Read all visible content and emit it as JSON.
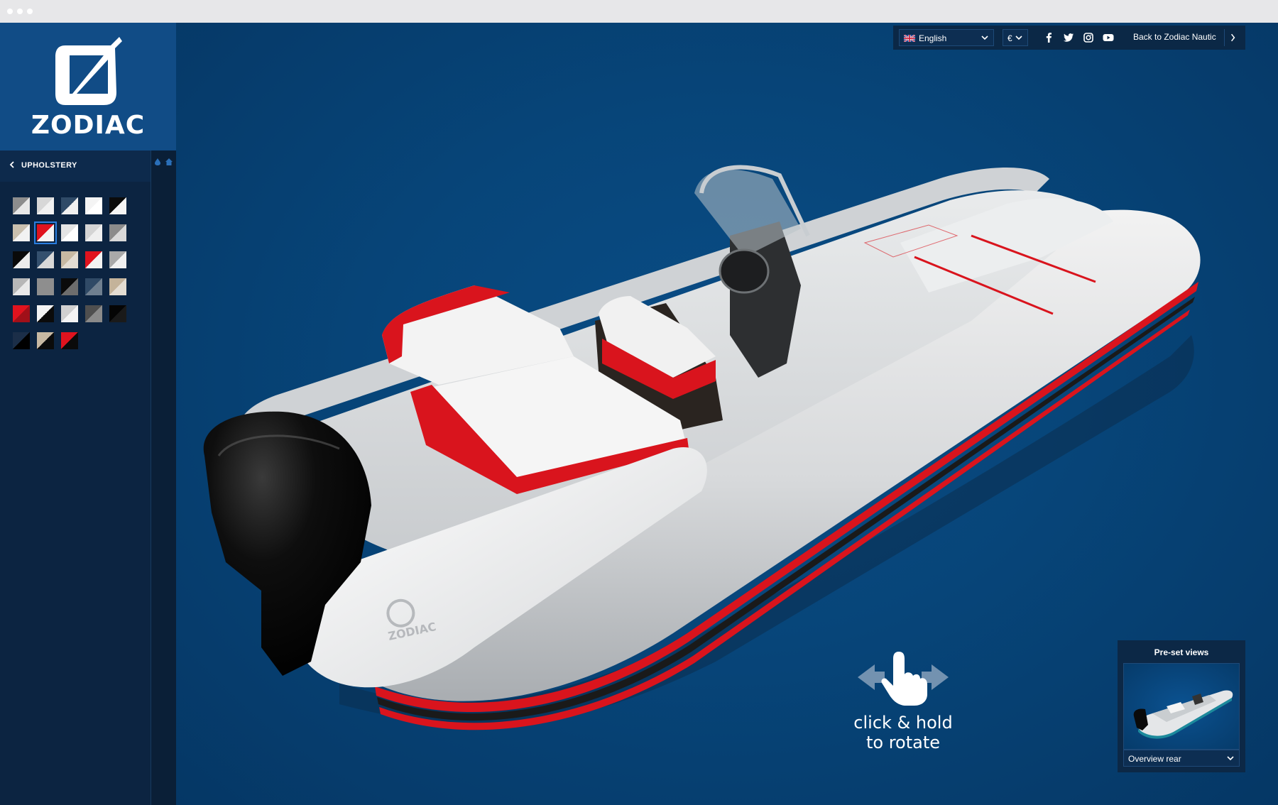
{
  "brand": {
    "logo_text": "ZODIAC"
  },
  "panel": {
    "title": "UPHOLSTERY"
  },
  "swatches": [
    {
      "a": "#8d8d8d",
      "b": "#e8e8e8",
      "selected": false
    },
    {
      "a": "#d7d7d7",
      "b": "#f1f1f1",
      "selected": false
    },
    {
      "a": "#2f4a67",
      "b": "#f0f0f0",
      "selected": false
    },
    {
      "a": "#f4f4f4",
      "b": "#ffffff",
      "selected": false
    },
    {
      "a": "#0b0b0b",
      "b": "#f5f5f5",
      "selected": false
    },
    {
      "a": "#c9bfae",
      "b": "#f2f2f2",
      "selected": false
    },
    {
      "a": "#e0131e",
      "b": "#f4f4f4",
      "selected": true
    },
    {
      "a": "#e4e4e4",
      "b": "#ffffff",
      "selected": false
    },
    {
      "a": "#d4d4d4",
      "b": "#efefef",
      "selected": false
    },
    {
      "a": "#8b8b8b",
      "b": "#d9d9d9",
      "selected": false
    },
    {
      "a": "#0a0a0a",
      "b": "#ececec",
      "selected": false
    },
    {
      "a": "#34506e",
      "b": "#d8d8d8",
      "selected": false
    },
    {
      "a": "#c7b9a3",
      "b": "#e3ddd3",
      "selected": false
    },
    {
      "a": "#e0131e",
      "b": "#f2f2f2",
      "selected": false
    },
    {
      "a": "#a9a9a9",
      "b": "#f0f0f0",
      "selected": false
    },
    {
      "a": "#b7b7b7",
      "b": "#e9e9e9",
      "selected": false
    },
    {
      "a": "#8e8e8e",
      "b": "#8e8e8e",
      "selected": false
    },
    {
      "a": "#0b0b0b",
      "b": "#6d6d6d",
      "selected": false
    },
    {
      "a": "#304a66",
      "b": "#6f7f8f",
      "selected": false
    },
    {
      "a": "#c4b39a",
      "b": "#e4ddd2",
      "selected": false
    },
    {
      "a": "#e0131e",
      "b": "#a01019",
      "selected": false
    },
    {
      "a": "#f4f4f4",
      "b": "#0b0b0b",
      "selected": false
    },
    {
      "a": "#d0d0d0",
      "b": "#f4f4f4",
      "selected": false
    },
    {
      "a": "#4f4f4f",
      "b": "#8a8a8a",
      "selected": false
    },
    {
      "a": "#050505",
      "b": "#1a1a1a",
      "selected": false
    },
    {
      "a": "#1b2e48",
      "b": "#000000",
      "selected": false
    },
    {
      "a": "#c7b9a3",
      "b": "#0b0b0b",
      "selected": false
    },
    {
      "a": "#e0131e",
      "b": "#0b0b0b",
      "selected": false
    }
  ],
  "topbar": {
    "language": "English",
    "currency": "€",
    "back_link": "Back to Zodiac Nautic",
    "social": [
      "facebook-icon",
      "twitter-icon",
      "instagram-icon",
      "youtube-icon"
    ]
  },
  "viewer": {
    "hint_line1": "click & hold",
    "hint_line2": "to rotate"
  },
  "preset": {
    "title": "Pre-set views",
    "selected_view": "Overview rear"
  },
  "colors": {
    "sidebar_bg": "#0c2441",
    "logo_bg": "#114c86",
    "viewer_bg": "#074579",
    "accent_red": "#e0131e"
  }
}
